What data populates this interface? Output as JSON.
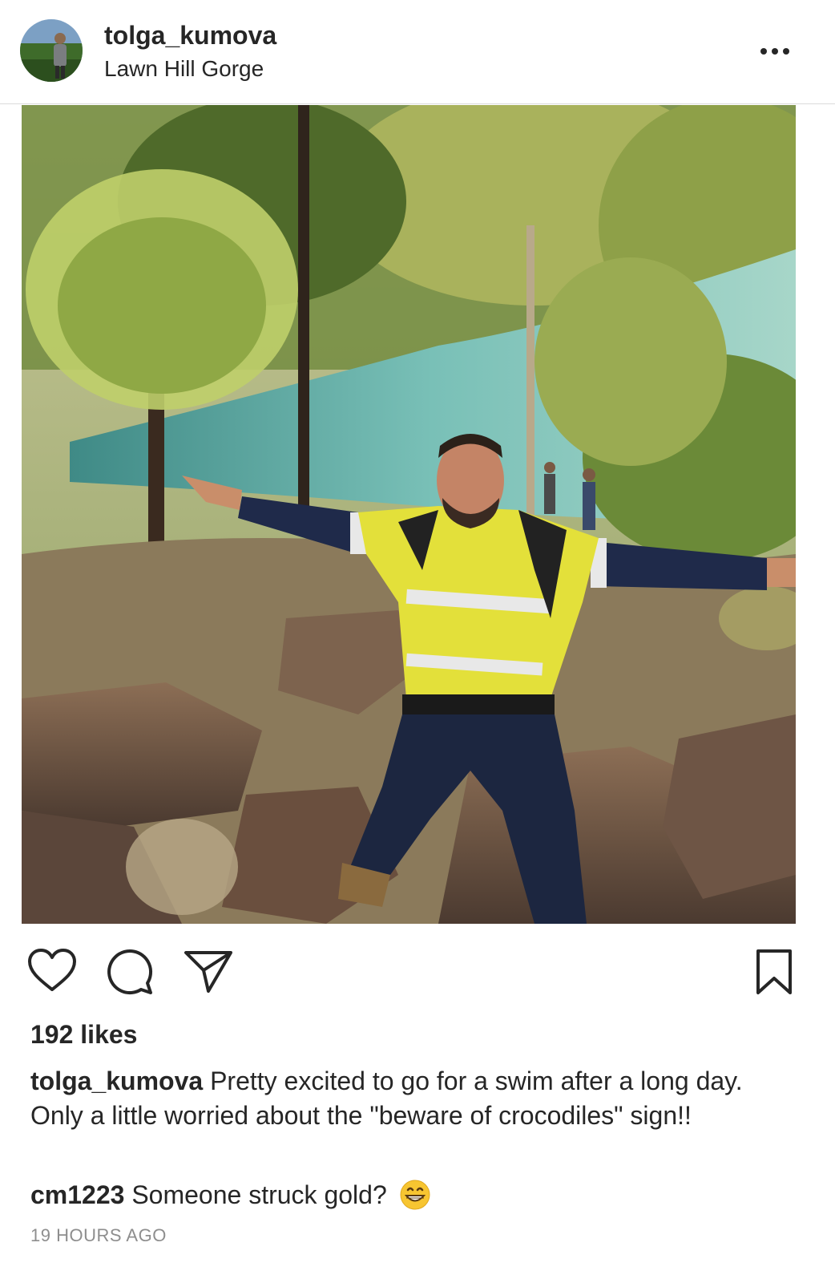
{
  "post": {
    "username": "tolga_kumova",
    "location": "Lawn Hill Gorge",
    "likes": "192 likes",
    "caption": {
      "user": "tolga_kumova",
      "text": "Pretty excited to go for a swim after a long day.",
      "text2": "Only a little worried about the \"beware of crocodiles\" sign!!"
    },
    "comment": {
      "user": "cm1223",
      "text": "Someone struck gold?",
      "emoji": "grinning-face-emoji"
    },
    "timestamp": "19 HOURS AGO"
  },
  "icons": {
    "more": "more-options-icon",
    "like": "heart-icon",
    "comment": "comment-icon",
    "share": "share-icon",
    "save": "bookmark-icon"
  },
  "colors": {
    "text": "#262626",
    "muted": "#8e8e8e",
    "divider": "#dbdbdb"
  }
}
